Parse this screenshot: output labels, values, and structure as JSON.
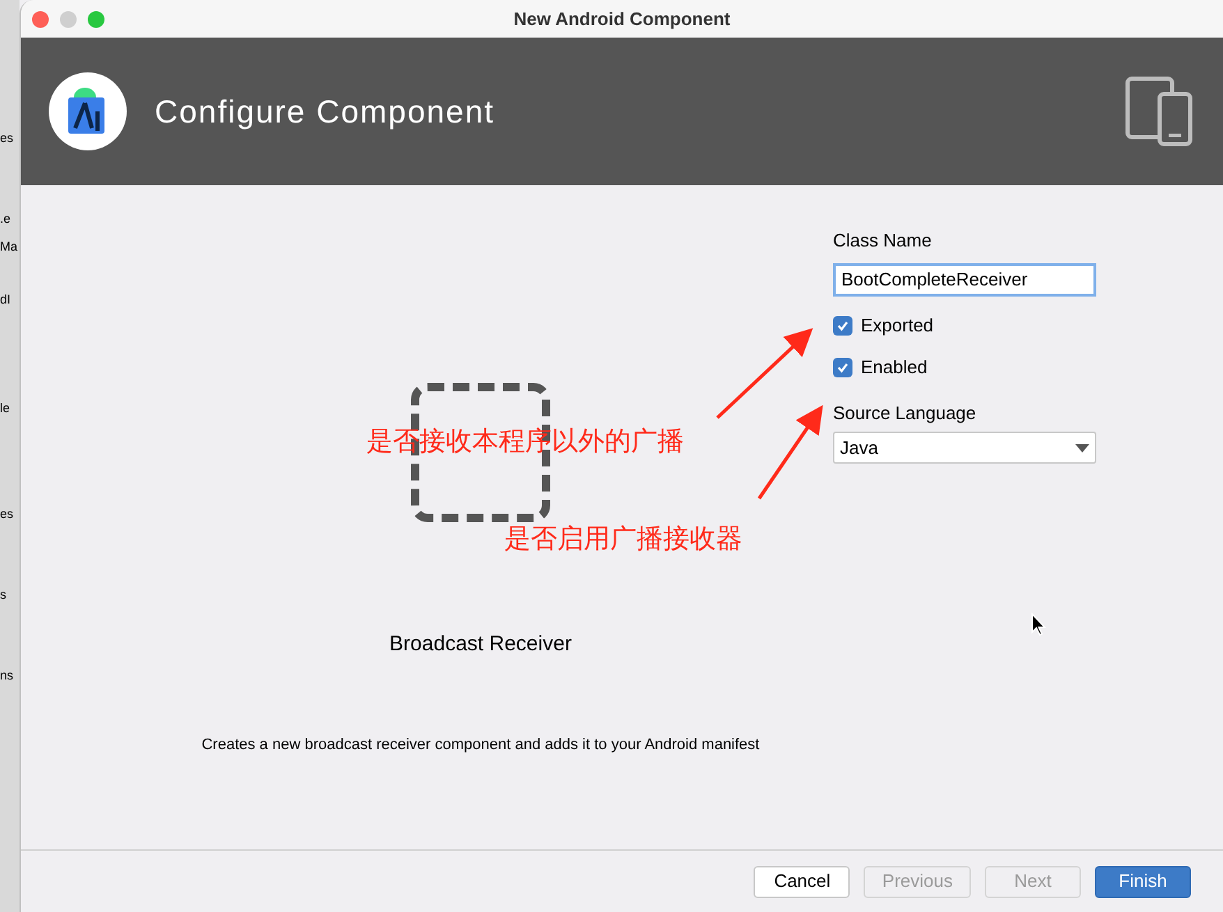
{
  "background_fragments": [
    "es",
    ".e",
    "Ma",
    "dI",
    "le",
    "es",
    "s",
    "ns"
  ],
  "window": {
    "title": "New Android Component"
  },
  "header": {
    "title": "Configure Component"
  },
  "preview": {
    "name": "Broadcast Receiver",
    "description": "Creates a new broadcast receiver component and adds it to your Android manifest"
  },
  "form": {
    "class_name_label": "Class Name",
    "class_name_value": "BootCompleteReceiver",
    "checkboxes": [
      {
        "label": "Exported",
        "checked": true
      },
      {
        "label": "Enabled",
        "checked": true
      }
    ],
    "language_label": "Source Language",
    "language_value": "Java"
  },
  "annotations": [
    "是否接收本程序以外的广播",
    "是否启用广播接收器"
  ],
  "buttons": [
    {
      "label": "Cancel",
      "kind": "default"
    },
    {
      "label": "Previous",
      "kind": "disabled"
    },
    {
      "label": "Next",
      "kind": "disabled"
    },
    {
      "label": "Finish",
      "kind": "primary"
    }
  ]
}
